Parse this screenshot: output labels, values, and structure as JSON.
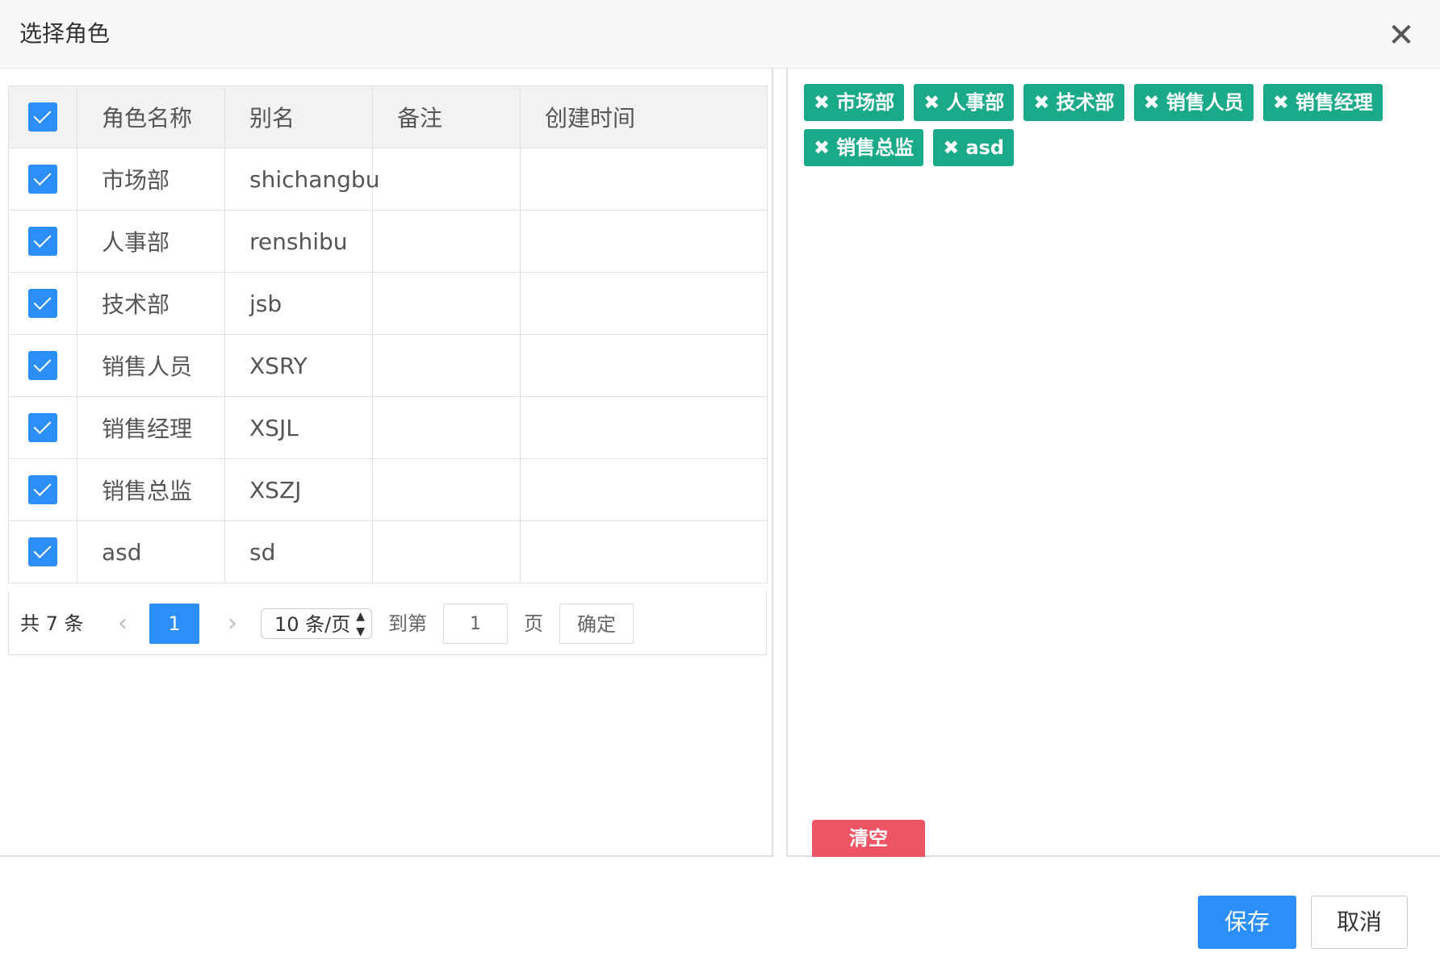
{
  "dialog": {
    "title": "选择角色",
    "close_label": "✕"
  },
  "table": {
    "columns": [
      "角色名称",
      "别名",
      "备注",
      "创建时间"
    ],
    "rows": [
      {
        "name": "市场部",
        "alias": "shichangbu",
        "remark": "",
        "created": ""
      },
      {
        "name": "人事部",
        "alias": "renshibu",
        "remark": "",
        "created": ""
      },
      {
        "name": "技术部",
        "alias": "jsb",
        "remark": "",
        "created": ""
      },
      {
        "name": "销售人员",
        "alias": "XSRY",
        "remark": "",
        "created": ""
      },
      {
        "name": "销售经理",
        "alias": "XSJL",
        "remark": "",
        "created": ""
      },
      {
        "name": "销售总监",
        "alias": "XSZJ",
        "remark": "",
        "created": ""
      },
      {
        "name": "asd",
        "alias": "sd",
        "remark": "",
        "created": ""
      }
    ]
  },
  "pager": {
    "total": "共 7 条",
    "prev": "‹",
    "current_page": "1",
    "next": "›",
    "page_size": "10 条/页",
    "goto_label": "到第",
    "goto_value": "1",
    "page_unit": "页",
    "confirm": "确定"
  },
  "selected": {
    "tags": [
      "市场部",
      "人事部",
      "技术部",
      "销售人员",
      "销售经理",
      "销售总监",
      "asd"
    ],
    "remove_glyph": "✖",
    "clear_label": "清空"
  },
  "footer": {
    "save_label": "保存",
    "cancel_label": "取消"
  },
  "colors": {
    "primary": "#2c8ef8",
    "tag": "#1aaa8a",
    "danger": "#ed5565"
  }
}
